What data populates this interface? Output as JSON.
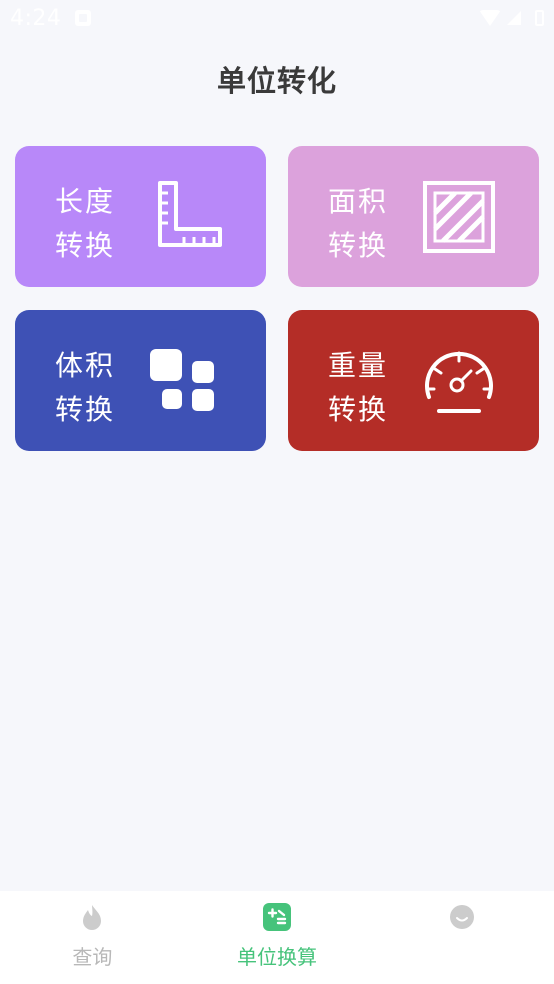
{
  "status_bar": {
    "time": "4:24"
  },
  "page": {
    "title": "单位转化"
  },
  "cards": [
    {
      "line1": "长度",
      "line2": "转换",
      "icon": "ruler-icon",
      "color": "#b888f9"
    },
    {
      "line1": "面积",
      "line2": "转换",
      "icon": "area-hatch-icon",
      "color": "#dca2dc"
    },
    {
      "line1": "体积",
      "line2": "转换",
      "icon": "blocks-icon",
      "color": "#3e51b5"
    },
    {
      "line1": "重量",
      "line2": "转换",
      "icon": "gauge-icon",
      "color": "#b42d27"
    }
  ],
  "bottom_nav": {
    "items": [
      {
        "label": "查询",
        "icon": "flame-icon",
        "active": false
      },
      {
        "label": "单位换算",
        "icon": "calculator-icon",
        "active": true
      },
      {
        "label": "",
        "icon": "smile-icon",
        "active": false
      }
    ],
    "active_color": "#46c37b",
    "inactive_color": "#b8b8b8"
  }
}
